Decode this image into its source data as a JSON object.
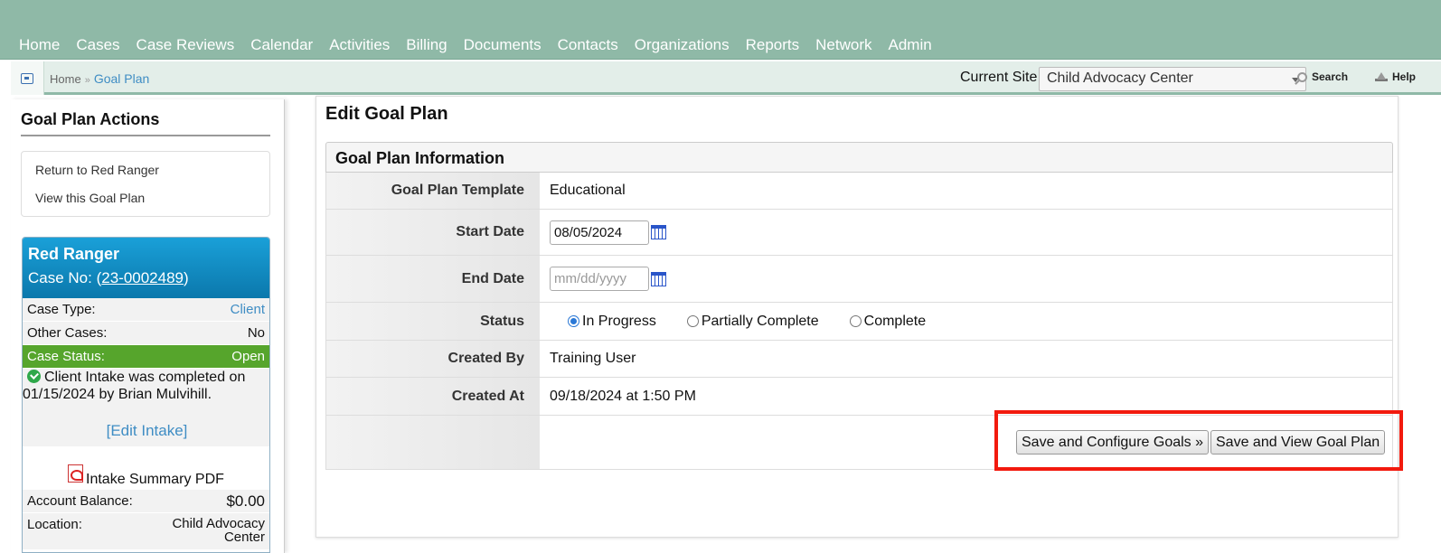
{
  "nav": {
    "items": [
      "Home",
      "Cases",
      "Case Reviews",
      "Calendar",
      "Activities",
      "Billing",
      "Documents",
      "Contacts",
      "Organizations",
      "Reports",
      "Network",
      "Admin"
    ]
  },
  "breadcrumb": {
    "home": "Home",
    "separator": "»",
    "current": "Goal Plan"
  },
  "site": {
    "label": "Current Site",
    "selected": "Child Advocacy Center"
  },
  "tools": {
    "search": "Search",
    "help": "Help"
  },
  "sidebar": {
    "title": "Goal Plan Actions",
    "actions": [
      "Return to Red Ranger",
      "View this Goal Plan"
    ],
    "case": {
      "name": "Red Ranger",
      "case_no_prefix": "Case No: (",
      "case_no": "23-0002489",
      "case_no_suffix": ")",
      "case_type_label": "Case Type:",
      "case_type": "Client",
      "other_cases_label": "Other Cases:",
      "other_cases": "No",
      "status_label": "Case Status:",
      "status": "Open",
      "intake_msg": "Client Intake was completed on 01/15/2024 by Brian Mulvihill.",
      "edit_intake": "[Edit Intake]",
      "intake_pdf": "Intake Summary PDF",
      "balance_label": "Account Balance:",
      "balance": "$0.00",
      "location_label": "Location:",
      "location": "Child Advocacy Center"
    }
  },
  "main": {
    "title": "Edit Goal Plan",
    "section": "Goal Plan Information",
    "fields": {
      "template_label": "Goal Plan Template",
      "template": "Educational",
      "start_label": "Start Date",
      "start_value": "08/05/2024",
      "end_label": "End Date",
      "end_placeholder": "mm/dd/yyyy",
      "status_label": "Status",
      "status_options": [
        "In Progress",
        "Partially Complete",
        "Complete"
      ],
      "status_selected": "In Progress",
      "created_by_label": "Created By",
      "created_by": "Training User",
      "created_at_label": "Created At",
      "created_at": "09/18/2024 at 1:50 PM"
    },
    "buttons": {
      "configure": "Save and Configure Goals »",
      "view": "Save and View Goal Plan"
    }
  },
  "colors": {
    "nav_bg": "#8fb9a7",
    "case_head": "#0b78ac",
    "status_green": "#56a52c",
    "link": "#3f8dc4",
    "highlight": "#f21a0e"
  }
}
